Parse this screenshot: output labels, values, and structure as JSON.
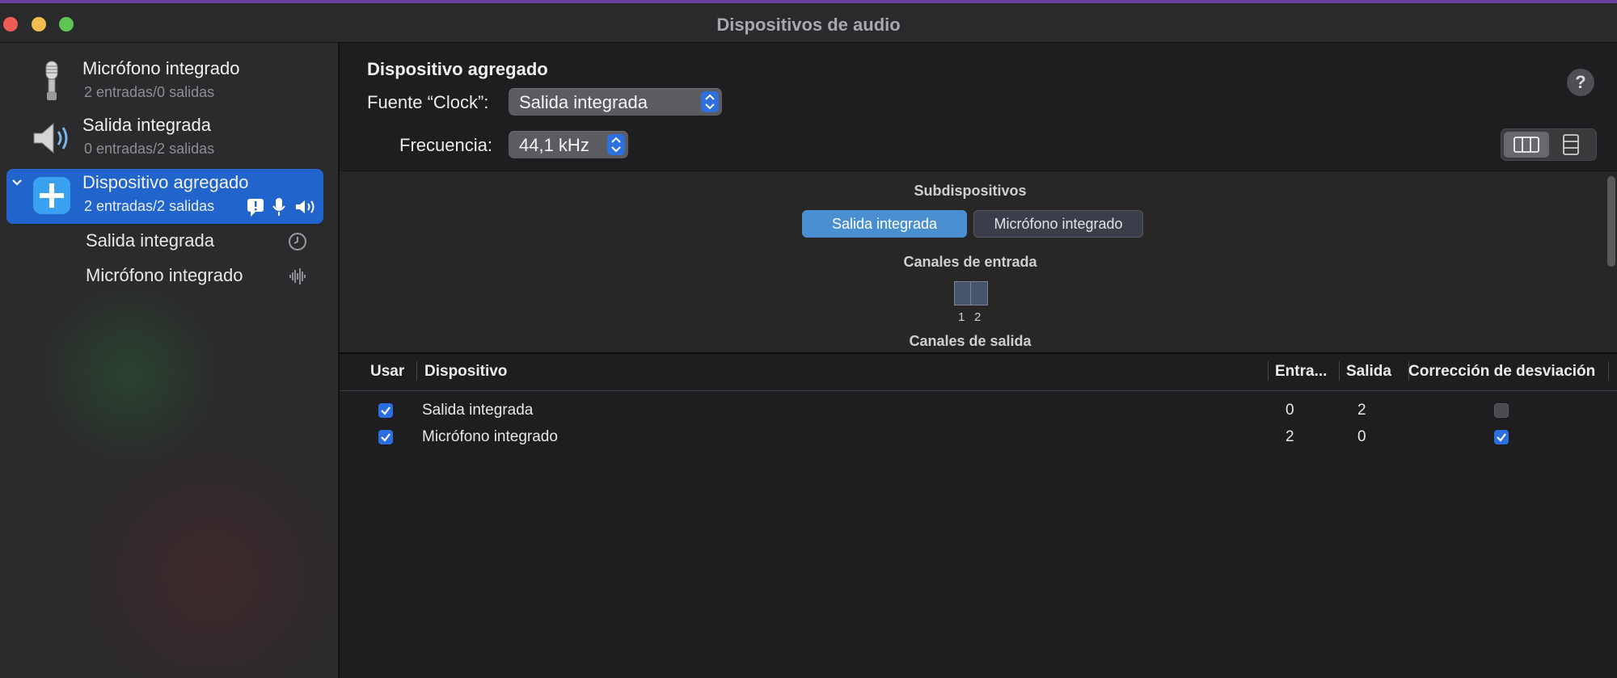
{
  "window": {
    "title": "Dispositivos de audio"
  },
  "sidebar": {
    "devices": [
      {
        "name": "Micrófono integrado",
        "io": "2 entradas/0 salidas",
        "icon": "microphone-icon"
      },
      {
        "name": "Salida integrada",
        "io": "0 entradas/2 salidas",
        "icon": "speaker-icon"
      },
      {
        "name": "Dispositivo agregado",
        "io": "2 entradas/2 salidas",
        "icon": "plus-icon",
        "selected": true,
        "badges": [
          "alert-icon",
          "microphone-small-icon",
          "speaker-small-icon"
        ]
      }
    ],
    "subdevices": [
      {
        "name": "Salida integrada",
        "icon": "clock-icon"
      },
      {
        "name": "Micrófono integrado",
        "icon": "waveform-icon"
      }
    ]
  },
  "main": {
    "title": "Dispositivo agregado",
    "clock_label": "Fuente “Clock”:",
    "clock_value": "Salida integrada",
    "freq_label": "Frecuencia:",
    "freq_value": "44,1 kHz",
    "help": "?",
    "panel": {
      "subdevices_title": "Subdispositivos",
      "tabs": [
        "Salida integrada",
        "Micrófono integrado"
      ],
      "input_title": "Canales de entrada",
      "channels": [
        "1",
        "2"
      ],
      "output_title": "Canales de salida"
    },
    "table": {
      "headers": [
        "Usar",
        "Dispositivo",
        "Entra...",
        "Salida",
        "Corrección de desviación"
      ],
      "rows": [
        {
          "use": true,
          "device": "Salida integrada",
          "in": "0",
          "out": "2",
          "drift": false
        },
        {
          "use": true,
          "device": "Micrófono integrado",
          "in": "2",
          "out": "0",
          "drift": true
        }
      ]
    }
  },
  "colors": {
    "accent": "#2164cb",
    "subtab_active": "#4a8fd1",
    "checkbox": "#2a6ee0"
  }
}
